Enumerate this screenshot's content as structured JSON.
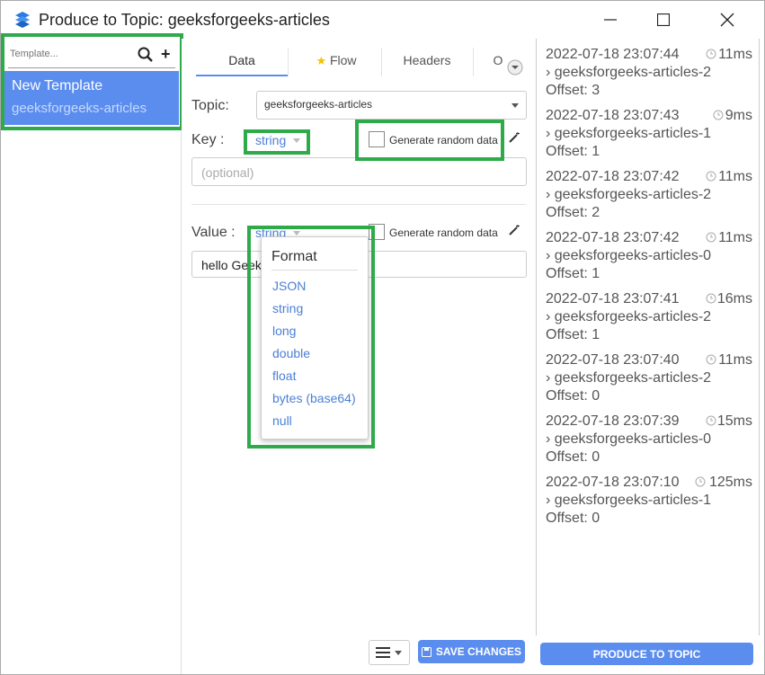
{
  "window": {
    "title": "Produce to Topic: geeksforgeeks-articles"
  },
  "templates": {
    "search_placeholder": "Template...",
    "items": [
      {
        "name": "New Template",
        "topic": "geeksforgeeks-articles"
      }
    ]
  },
  "tabs": [
    {
      "label": "Data",
      "active": true
    },
    {
      "label": "Flow",
      "icon": "star-icon"
    },
    {
      "label": "Headers"
    },
    {
      "label": "O"
    }
  ],
  "form": {
    "topic_label": "Topic:",
    "topic_value": "geeksforgeeks-articles",
    "key_label": "Key :",
    "key_format": "string",
    "key_placeholder": "(optional)",
    "generate_random": "Generate random data",
    "value_label": "Value :",
    "value_format": "string",
    "value_text": "hello Geeks"
  },
  "format_menu": {
    "title": "Format",
    "options": [
      "JSON",
      "string",
      "long",
      "double",
      "float",
      "bytes (base64)",
      "null"
    ]
  },
  "toolbar": {
    "save_label": "SAVE CHANGES",
    "produce_label": "PRODUCE TO TOPIC"
  },
  "messages": [
    {
      "time": "2022-07-18 23:07:44",
      "duration": "11ms",
      "topic": "geeksforgeeks-articles-2",
      "offset": "Offset: 3"
    },
    {
      "time": "2022-07-18 23:07:43",
      "duration": "9ms",
      "topic": "geeksforgeeks-articles-1",
      "offset": "Offset: 1"
    },
    {
      "time": "2022-07-18 23:07:42",
      "duration": "11ms",
      "topic": "geeksforgeeks-articles-2",
      "offset": "Offset: 2"
    },
    {
      "time": "2022-07-18 23:07:42",
      "duration": "11ms",
      "topic": "geeksforgeeks-articles-0",
      "offset": "Offset: 1"
    },
    {
      "time": "2022-07-18 23:07:41",
      "duration": "16ms",
      "topic": "geeksforgeeks-articles-2",
      "offset": "Offset: 1"
    },
    {
      "time": "2022-07-18 23:07:40",
      "duration": "11ms",
      "topic": "geeksforgeeks-articles-2",
      "offset": "Offset: 0"
    },
    {
      "time": "2022-07-18 23:07:39",
      "duration": "15ms",
      "topic": "geeksforgeeks-articles-0",
      "offset": "Offset: 0"
    },
    {
      "time": "2022-07-18 23:07:10",
      "duration": "125ms",
      "topic": "geeksforgeeks-articles-1",
      "offset": "Offset: 0"
    }
  ],
  "colors": {
    "accent": "#5b8def",
    "highlight": "#2eaa4a",
    "link": "#4a7fd6"
  }
}
